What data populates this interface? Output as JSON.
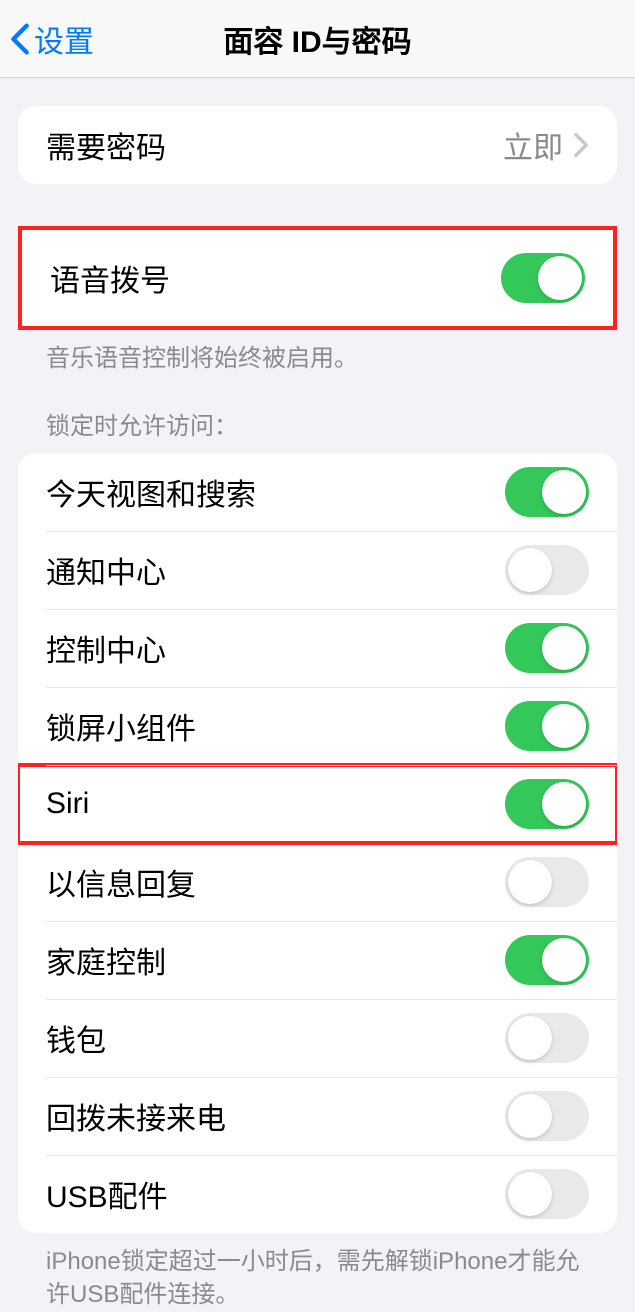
{
  "nav": {
    "back_label": "设置",
    "title": "面容 ID与密码"
  },
  "require_passcode": {
    "label": "需要密码",
    "value": "立即"
  },
  "voice_dial": {
    "label": "语音拨号",
    "on": true,
    "footer": "音乐语音控制将始终被启用。"
  },
  "lock_access": {
    "header": "锁定时允许访问：",
    "items": [
      {
        "label": "今天视图和搜索",
        "on": true,
        "highlight": false
      },
      {
        "label": "通知中心",
        "on": false,
        "highlight": false
      },
      {
        "label": "控制中心",
        "on": true,
        "highlight": false
      },
      {
        "label": "锁屏小组件",
        "on": true,
        "highlight": false
      },
      {
        "label": "Siri",
        "on": true,
        "highlight": true
      },
      {
        "label": "以信息回复",
        "on": false,
        "highlight": false
      },
      {
        "label": "家庭控制",
        "on": true,
        "highlight": false
      },
      {
        "label": "钱包",
        "on": false,
        "highlight": false
      },
      {
        "label": "回拨未接来电",
        "on": false,
        "highlight": false
      },
      {
        "label": "USB配件",
        "on": false,
        "highlight": false
      }
    ],
    "footer": "iPhone锁定超过一小时后，需先解锁iPhone才能允许USB配件连接。"
  }
}
